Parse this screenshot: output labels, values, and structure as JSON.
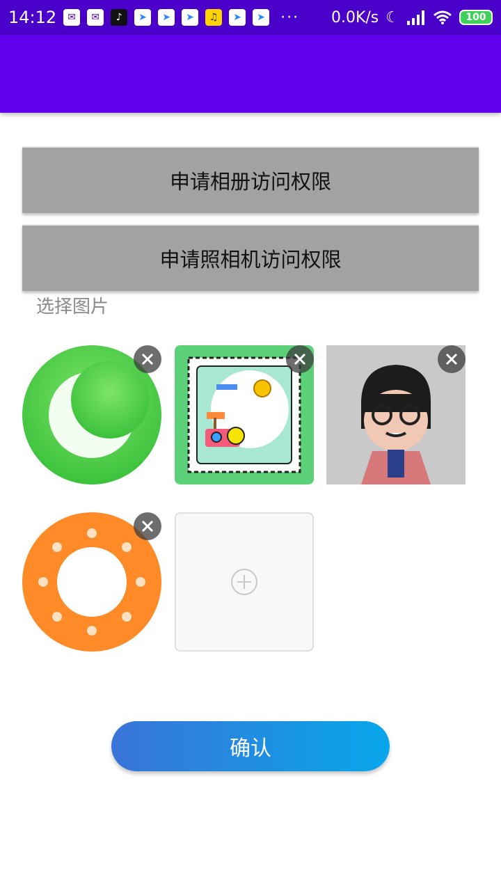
{
  "status_bar": {
    "time": "14:12",
    "more": "···",
    "net_speed": "0.0K/s",
    "battery": "100",
    "icons": [
      "message-icon",
      "message-icon",
      "tiktok-icon",
      "send-icon",
      "send-icon",
      "send-icon",
      "music-icon",
      "send-icon",
      "send-icon"
    ]
  },
  "buttons": {
    "album_permission": "申请相册访问权限",
    "camera_permission": "申请照相机访问权限",
    "confirm": "确认"
  },
  "picker": {
    "label": "选择图片",
    "images": [
      {
        "name": "moon-icon-image"
      },
      {
        "name": "stamp-travel-image"
      },
      {
        "name": "cartoon-girl-image"
      },
      {
        "name": "orange-ring-image"
      }
    ],
    "add_icon": "plus-icon",
    "delete_icon": "close-icon"
  },
  "colors": {
    "status_bar": "#4a00c8",
    "app_bar": "#6200ee",
    "permission_button": "#a2a2a2",
    "confirm_gradient_start": "#3a74d8",
    "confirm_gradient_end": "#08a6ec"
  }
}
